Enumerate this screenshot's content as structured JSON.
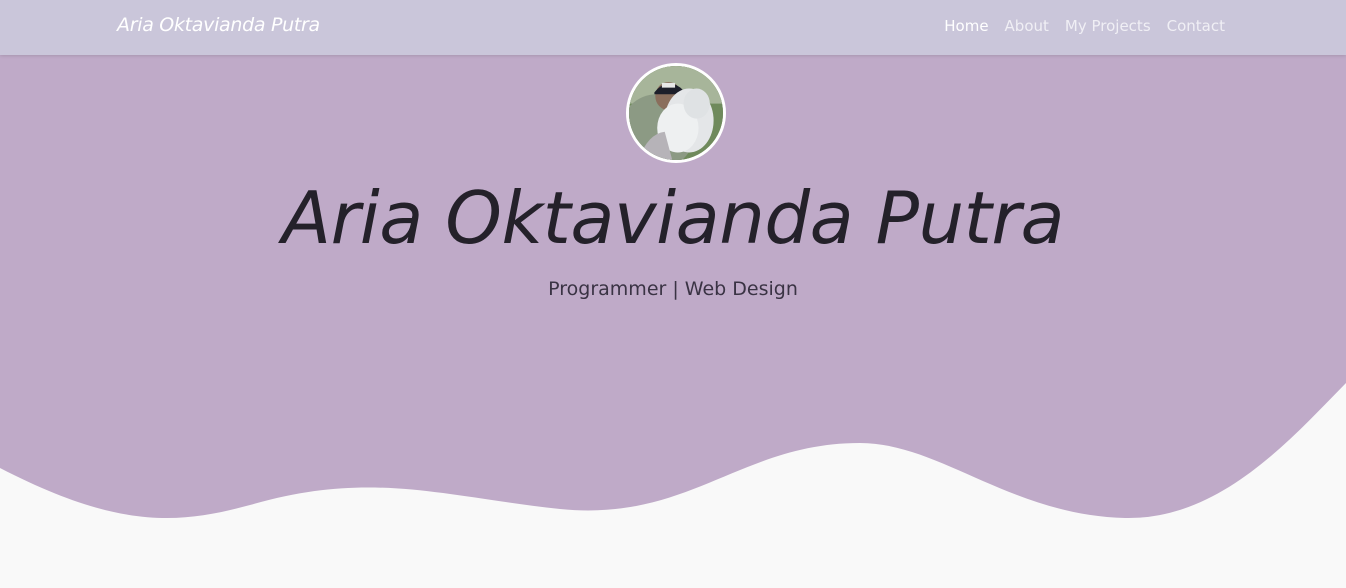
{
  "navbar": {
    "brand": "Aria Oktavianda Putra",
    "links": [
      {
        "label": "Home",
        "active": true
      },
      {
        "label": "About",
        "active": false
      },
      {
        "label": "My Projects",
        "active": false
      },
      {
        "label": "Contact",
        "active": false
      }
    ]
  },
  "hero": {
    "name": "Aria Oktavianda Putra",
    "subtitle": "Programmer | Web Design",
    "avatar_icon": "profile-photo"
  },
  "colors": {
    "hero_bg": "#bfaac8",
    "navbar_bg": "#cac6da",
    "page_bg": "#f9f9f9",
    "heading_text": "#24212a"
  }
}
